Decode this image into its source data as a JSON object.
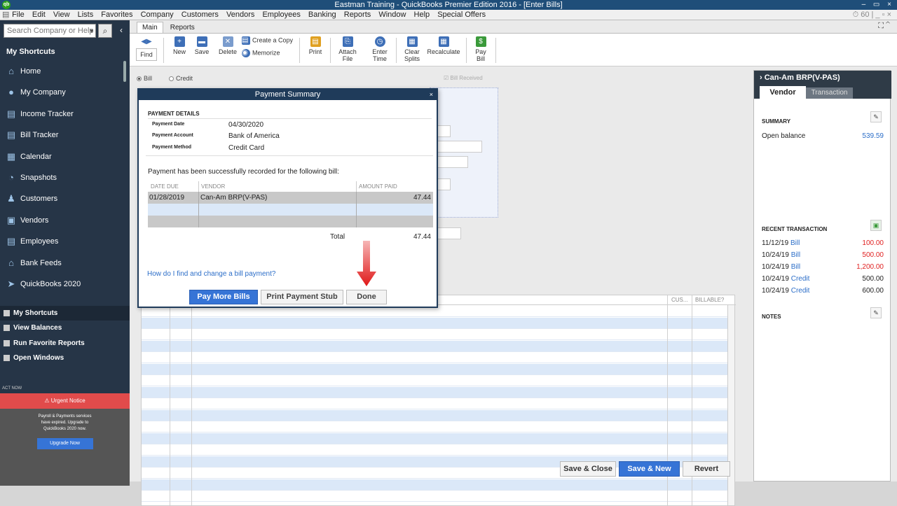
{
  "window": {
    "title": "Eastman Training  - QuickBooks Premier Edition 2016 - [Enter Bills]",
    "logo": "qb",
    "controls": "– ▭ ×"
  },
  "menubar": {
    "items": [
      "File",
      "Edit",
      "View",
      "Lists",
      "Favorites",
      "Company",
      "Customers",
      "Vendors",
      "Employees",
      "Banking",
      "Reports",
      "Window",
      "Help",
      "Special Offers"
    ],
    "right_icons": "⏱ 60 | _ ▫ ×"
  },
  "sidebar": {
    "search_placeholder": "Search Company or Help",
    "search_dropdown": "▾",
    "search_button": "⌕",
    "collapse_button": "‹",
    "header": "My Shortcuts",
    "items": [
      {
        "label": "Home",
        "icon": "⌂"
      },
      {
        "label": "My Company",
        "icon": "●"
      },
      {
        "label": "Income Tracker",
        "icon": "▤"
      },
      {
        "label": "Bill Tracker",
        "icon": "▤"
      },
      {
        "label": "Calendar",
        "icon": "▦"
      },
      {
        "label": "Snapshots",
        "icon": "◔"
      },
      {
        "label": "Customers",
        "icon": "♟"
      },
      {
        "label": "Vendors",
        "icon": "▣"
      },
      {
        "label": "Employees",
        "icon": "▤"
      },
      {
        "label": "Bank Feeds",
        "icon": "⌂"
      },
      {
        "label": "QuickBooks 2020",
        "icon": "➤"
      }
    ],
    "lower": [
      "My Shortcuts",
      "View Balances",
      "Run Favorite Reports",
      "Open Windows"
    ],
    "act_now": "ACT NOW",
    "urgent": "⚠ Urgent Notice",
    "urgent_lines": [
      "Payroll & Payments services",
      "have expired. Upgrade to",
      "QuickBooks 2020 now."
    ],
    "upgrade": "Upgrade Now"
  },
  "main": {
    "tabs": [
      "Main",
      "Reports"
    ],
    "topright": "⛶ ⌃",
    "toolbar": [
      {
        "label": "Find",
        "icon": "◀▶"
      },
      {
        "label": "New",
        "icon": "+"
      },
      {
        "label": "Save",
        "icon": "▬"
      },
      {
        "label": "Delete",
        "icon": "✕"
      },
      {
        "label": "Create a Copy",
        "icon": "▤"
      },
      {
        "label": "Memorize",
        "icon": "◉"
      },
      {
        "label": "Print",
        "icon": "▤"
      },
      {
        "label": "Attach\nFile",
        "icon": "⎘"
      },
      {
        "label": "Enter\nTime",
        "icon": "◷"
      },
      {
        "label": "Clear\nSplits",
        "icon": "▦"
      },
      {
        "label": "Recalculate",
        "icon": "▦"
      },
      {
        "label": "Pay\nBill",
        "icon": "$"
      }
    ],
    "radio_bill": "Bill",
    "radio_credit": "Credit",
    "bill_received": "Bill Received",
    "grid_headers": {
      "cus": "CUS...",
      "billable": "BILLABLE?"
    },
    "buttons": {
      "save_close": "Save & Close",
      "save_new": "Save & New",
      "revert": "Revert"
    }
  },
  "right_panel": {
    "vendor": "Can-Am BRP(V-PAS)",
    "tabs": [
      "Vendor",
      "Transaction"
    ],
    "summary_label": "SUMMARY",
    "open_balance_label": "Open balance",
    "open_balance_value": "539.59",
    "recent_label": "RECENT TRANSACTION",
    "recent": [
      {
        "date": "11/12/19",
        "type": "Bill",
        "amount": "100.00",
        "red": true
      },
      {
        "date": "10/24/19",
        "type": "Bill",
        "amount": "500.00",
        "red": true
      },
      {
        "date": "10/24/19",
        "type": "Bill",
        "amount": "1,200.00",
        "red": true
      },
      {
        "date": "10/24/19",
        "type": "Credit",
        "amount": "500.00",
        "red": false
      },
      {
        "date": "10/24/19",
        "type": "Credit",
        "amount": "600.00",
        "red": false
      }
    ],
    "notes_label": "NOTES",
    "edit_icon": "✎"
  },
  "dialog": {
    "title": "Payment Summary",
    "close": "×",
    "details_header": "PAYMENT DETAILS",
    "details": [
      {
        "label": "Payment Date",
        "value": "04/30/2020"
      },
      {
        "label": "Payment Account",
        "value": "Bank of America"
      },
      {
        "label": "Payment Method",
        "value": "Credit Card"
      }
    ],
    "success_text": "Payment has been successfully recorded for the following bill:",
    "columns": {
      "date": "DATE DUE",
      "vendor": "VENDOR",
      "amount": "AMOUNT PAID"
    },
    "rows": [
      {
        "date": "01/28/2019",
        "vendor": "Can-Am BRP(V-PAS)",
        "amount": "47.44"
      }
    ],
    "total_label": "Total",
    "total_value": "47.44",
    "help_link": "How do I find and change a bill payment?",
    "buttons": {
      "pay_more": "Pay More Bills",
      "print_stub": "Print Payment Stub",
      "done": "Done"
    }
  }
}
